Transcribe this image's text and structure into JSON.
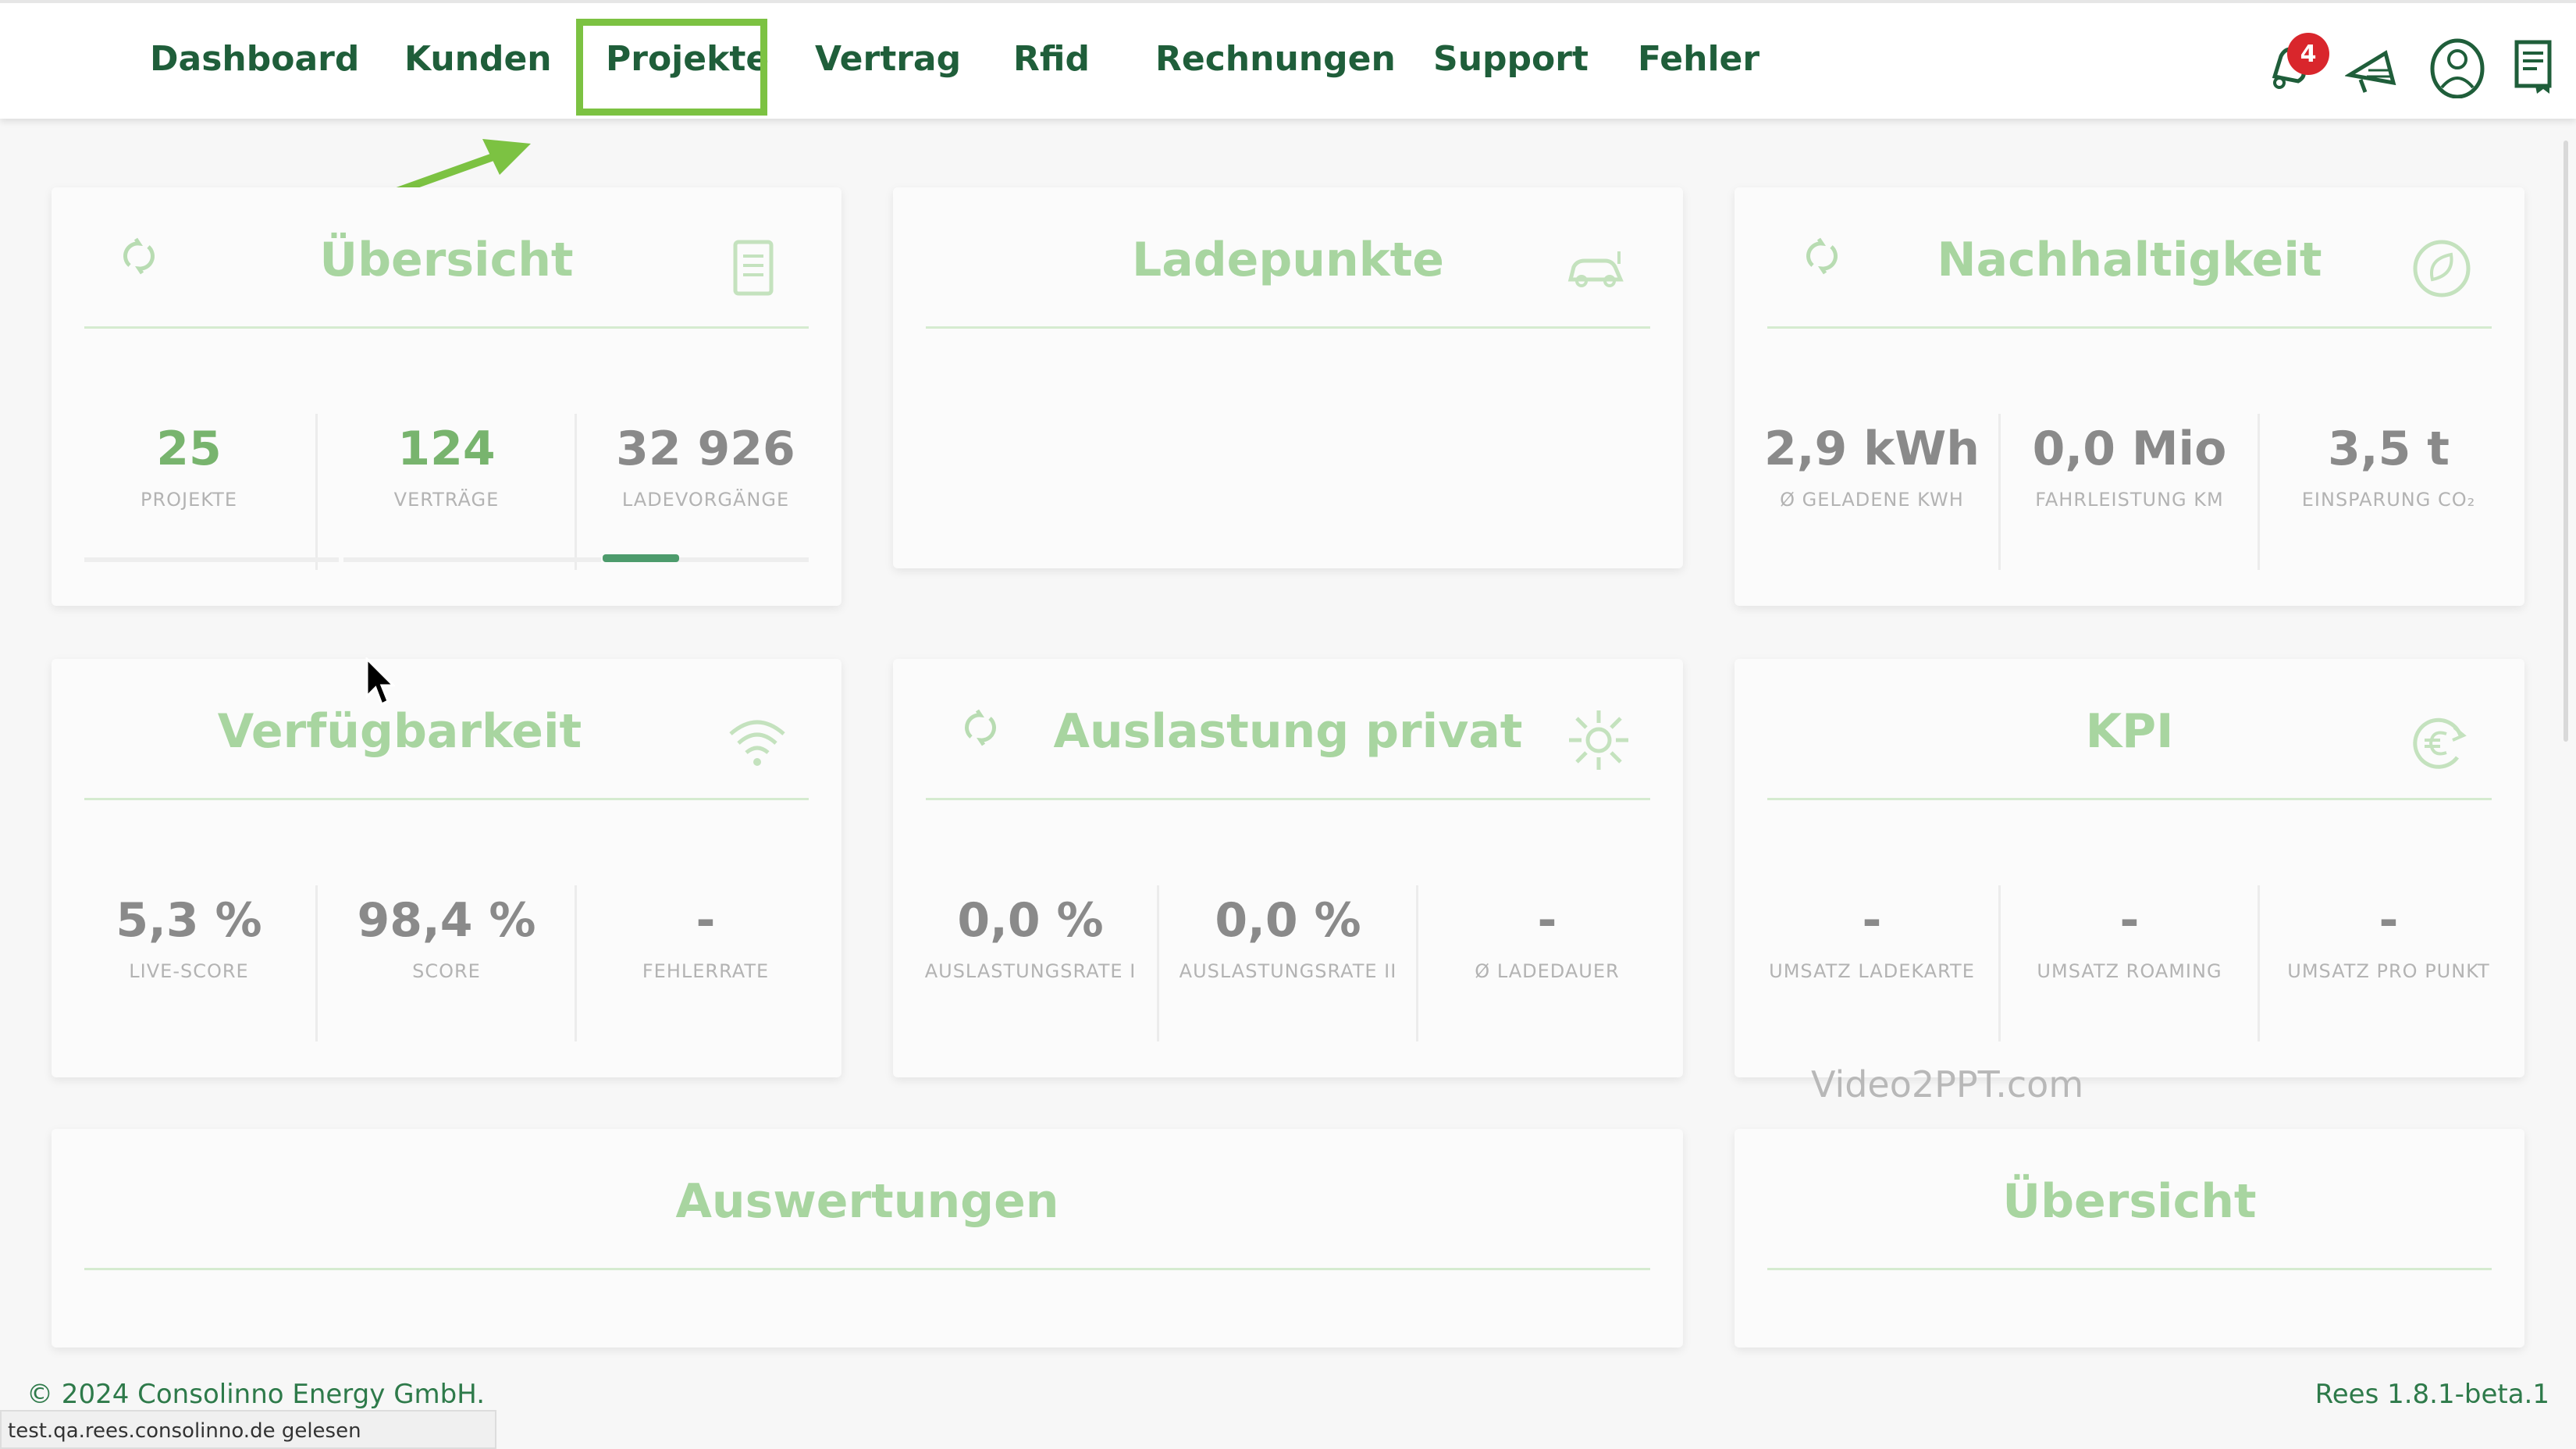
{
  "nav": {
    "items": [
      "Dashboard",
      "Kunden",
      "Projekte",
      "Vertrag",
      "Rfid",
      "Rechnungen",
      "Support",
      "Fehler"
    ],
    "active": "Projekte",
    "notification_count": "4"
  },
  "cards": {
    "uebersicht": {
      "title": "Übersicht",
      "stats": [
        {
          "value": "25",
          "label": "PROJEKTE"
        },
        {
          "value": "124",
          "label": "VERTRÄGE"
        },
        {
          "value": "32 926",
          "label": "LADEVORGÄNGE"
        }
      ]
    },
    "ladepunkte": {
      "title": "Ladepunkte"
    },
    "nachhaltigkeit": {
      "title": "Nachhaltigkeit",
      "stats": [
        {
          "value": "2,9 kWh",
          "label": "Ø GELADENE KWH"
        },
        {
          "value": "0,0 Mio",
          "label": "FAHRLEISTUNG KM"
        },
        {
          "value": "3,5 t",
          "label": "EINSPARUNG CO₂"
        }
      ]
    },
    "verfuegbarkeit": {
      "title": "Verfügbarkeit",
      "stats": [
        {
          "value": "5,3 %",
          "label": "LIVE-SCORE"
        },
        {
          "value": "98,4 %",
          "label": "SCORE"
        },
        {
          "value": "-",
          "label": "FEHLERRATE"
        }
      ]
    },
    "auslastung": {
      "title": "Auslastung privat",
      "stats": [
        {
          "value": "0,0 %",
          "label": "AUSLASTUNGSRATE I"
        },
        {
          "value": "0,0 %",
          "label": "AUSLASTUNGSRATE II"
        },
        {
          "value": "-",
          "label": "Ø LADEDAUER"
        }
      ]
    },
    "kpi": {
      "title": "KPI",
      "stats": [
        {
          "value": "-",
          "label": "UMSATZ LADEKARTE"
        },
        {
          "value": "-",
          "label": "UMSATZ ROAMING"
        },
        {
          "value": "-",
          "label": "UMSATZ PRO PUNKT"
        }
      ]
    },
    "auswertungen": {
      "title": "Auswertungen"
    },
    "uebersicht2": {
      "title": "Übersicht"
    }
  },
  "footer": {
    "copyright": "© 2024 Consolinno Energy GmbH.",
    "version": "Rees 1.8.1-beta.1",
    "status_url": "test.qa.rees.consolinno.de gelesen"
  },
  "watermark": "Video2PPT.com",
  "colors": {
    "brand_dark": "#1f5e3a",
    "title_green": "#a8d5a0",
    "highlight": "#7cc242",
    "badge": "#d9262c"
  },
  "icons": {
    "bell": "bell-icon",
    "megaphone": "megaphone-icon",
    "user": "user-icon",
    "document": "document-icon",
    "refresh": "refresh-icon"
  }
}
